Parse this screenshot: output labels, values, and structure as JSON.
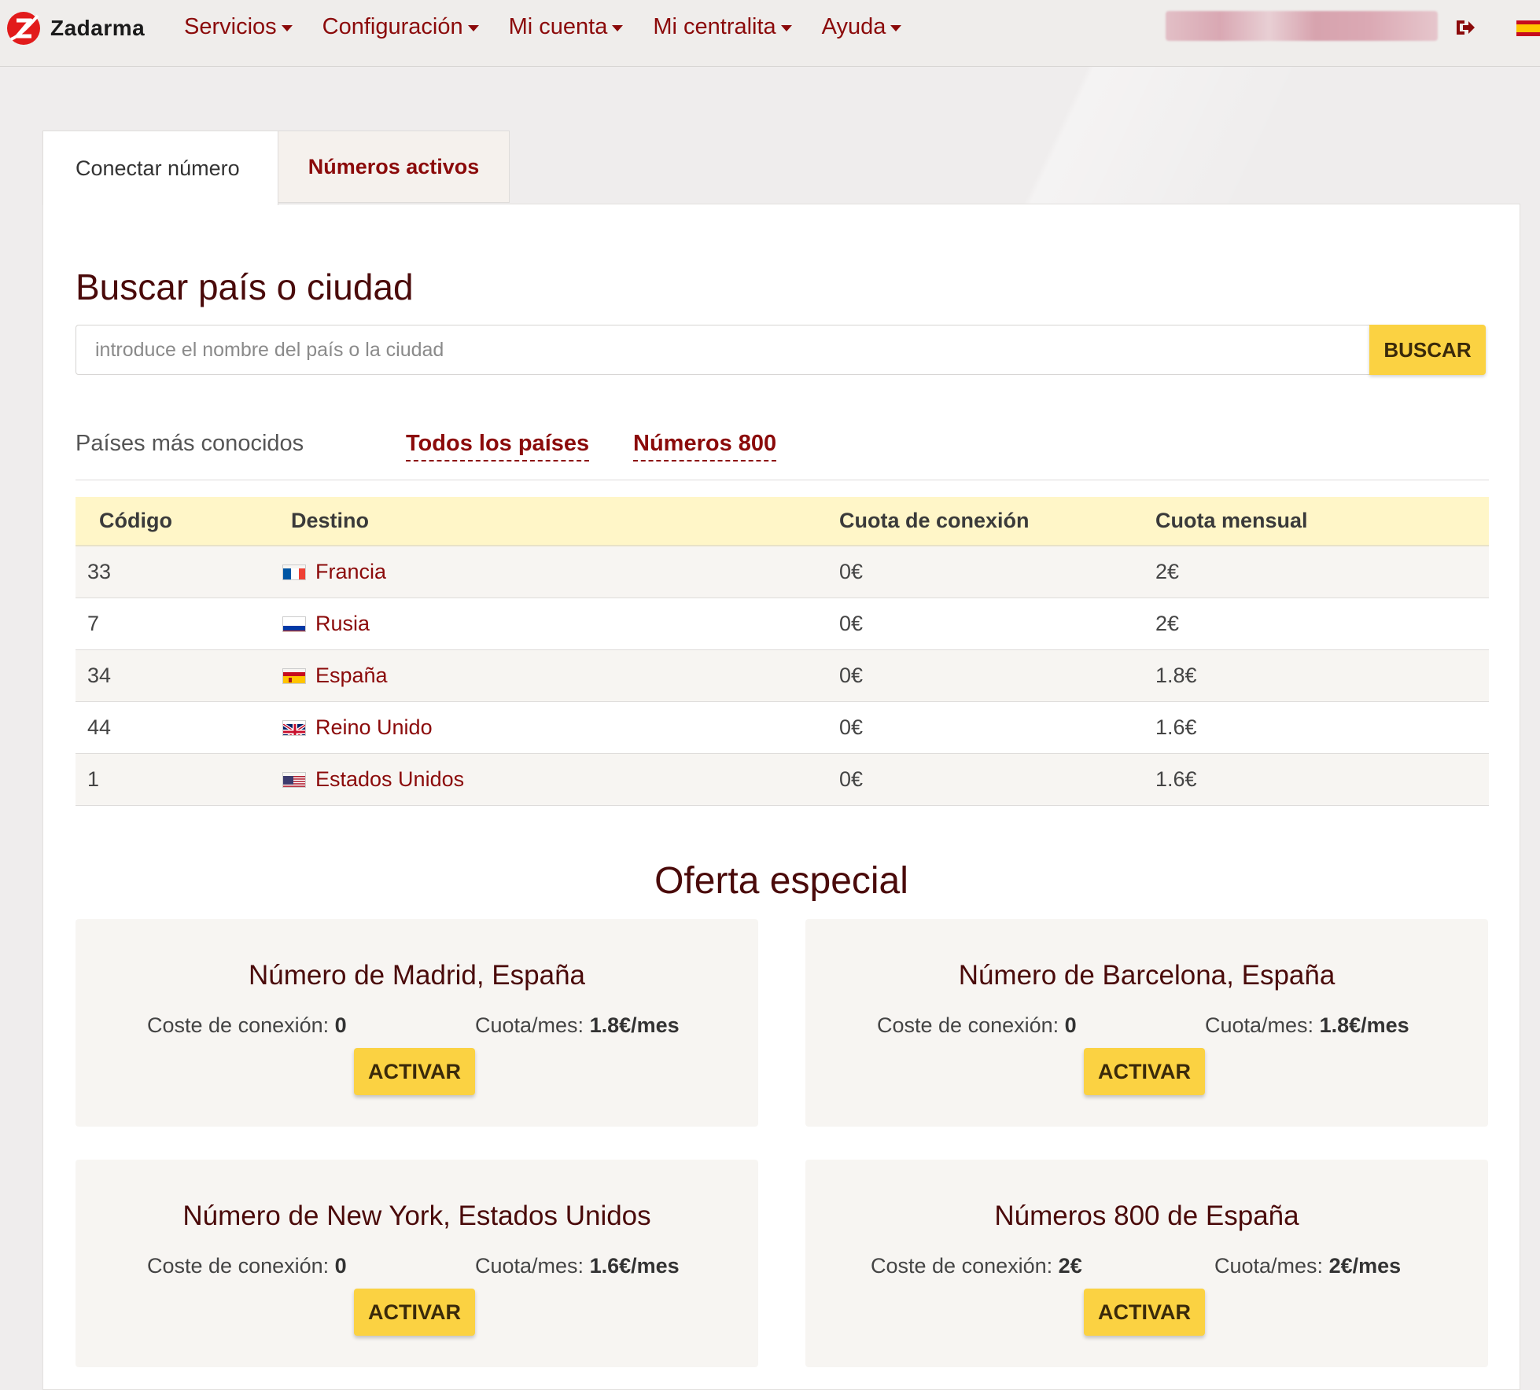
{
  "header": {
    "brand": "Zadarma",
    "nav": [
      {
        "label": "Servicios"
      },
      {
        "label": "Configuración"
      },
      {
        "label": "Mi cuenta"
      },
      {
        "label": "Mi centralita"
      },
      {
        "label": "Ayuda"
      }
    ],
    "icons": [
      "zadarma-logo-icon",
      "logout-icon",
      "spain-flag-icon"
    ],
    "accent_color": "#8b0a0a"
  },
  "tabs": {
    "connect": "Conectar número",
    "active": "Números activos"
  },
  "search": {
    "title": "Buscar país o ciudad",
    "placeholder": "introduce el nombre del país o la ciudad",
    "button": "BUSCAR"
  },
  "subtabs": {
    "popular": "Países más conocidos",
    "all": "Todos los países",
    "toll_free": "Números 800"
  },
  "table": {
    "headers": {
      "code": "Código",
      "destination": "Destino",
      "connection_fee": "Cuota de conexión",
      "monthly_fee": "Cuota mensual"
    },
    "rows": [
      {
        "code": "33",
        "country": "Francia",
        "flag": "france-flag-icon",
        "connection": "0€",
        "monthly": "2€"
      },
      {
        "code": "7",
        "country": "Rusia",
        "flag": "russia-flag-icon",
        "connection": "0€",
        "monthly": "2€"
      },
      {
        "code": "34",
        "country": "España",
        "flag": "spain-flag-icon",
        "connection": "0€",
        "monthly": "1.8€"
      },
      {
        "code": "44",
        "country": "Reino Unido",
        "flag": "uk-flag-icon",
        "connection": "0€",
        "monthly": "1.6€"
      },
      {
        "code": "1",
        "country": "Estados Unidos",
        "flag": "usa-flag-icon",
        "connection": "0€",
        "monthly": "1.6€"
      }
    ]
  },
  "offers": {
    "title": "Oferta especial",
    "connection_label": "Coste de conexión:",
    "monthly_label": "Cuota/mes:",
    "button": "ACTIVAR",
    "items": [
      {
        "title": "Número de Madrid, España",
        "connection": "0",
        "monthly": "1.8€/mes"
      },
      {
        "title": "Número de Barcelona, España",
        "connection": "0",
        "monthly": "1.8€/mes"
      },
      {
        "title": "Número de New York, Estados Unidos",
        "connection": "0",
        "monthly": "1.6€/mes"
      },
      {
        "title": "Números 800 de España",
        "connection": "2€",
        "monthly": "2€/mes"
      }
    ]
  },
  "colors": {
    "button_yellow": "#fbd242",
    "table_header_bg": "#fff6c8",
    "title_color": "#4a0a0a"
  }
}
